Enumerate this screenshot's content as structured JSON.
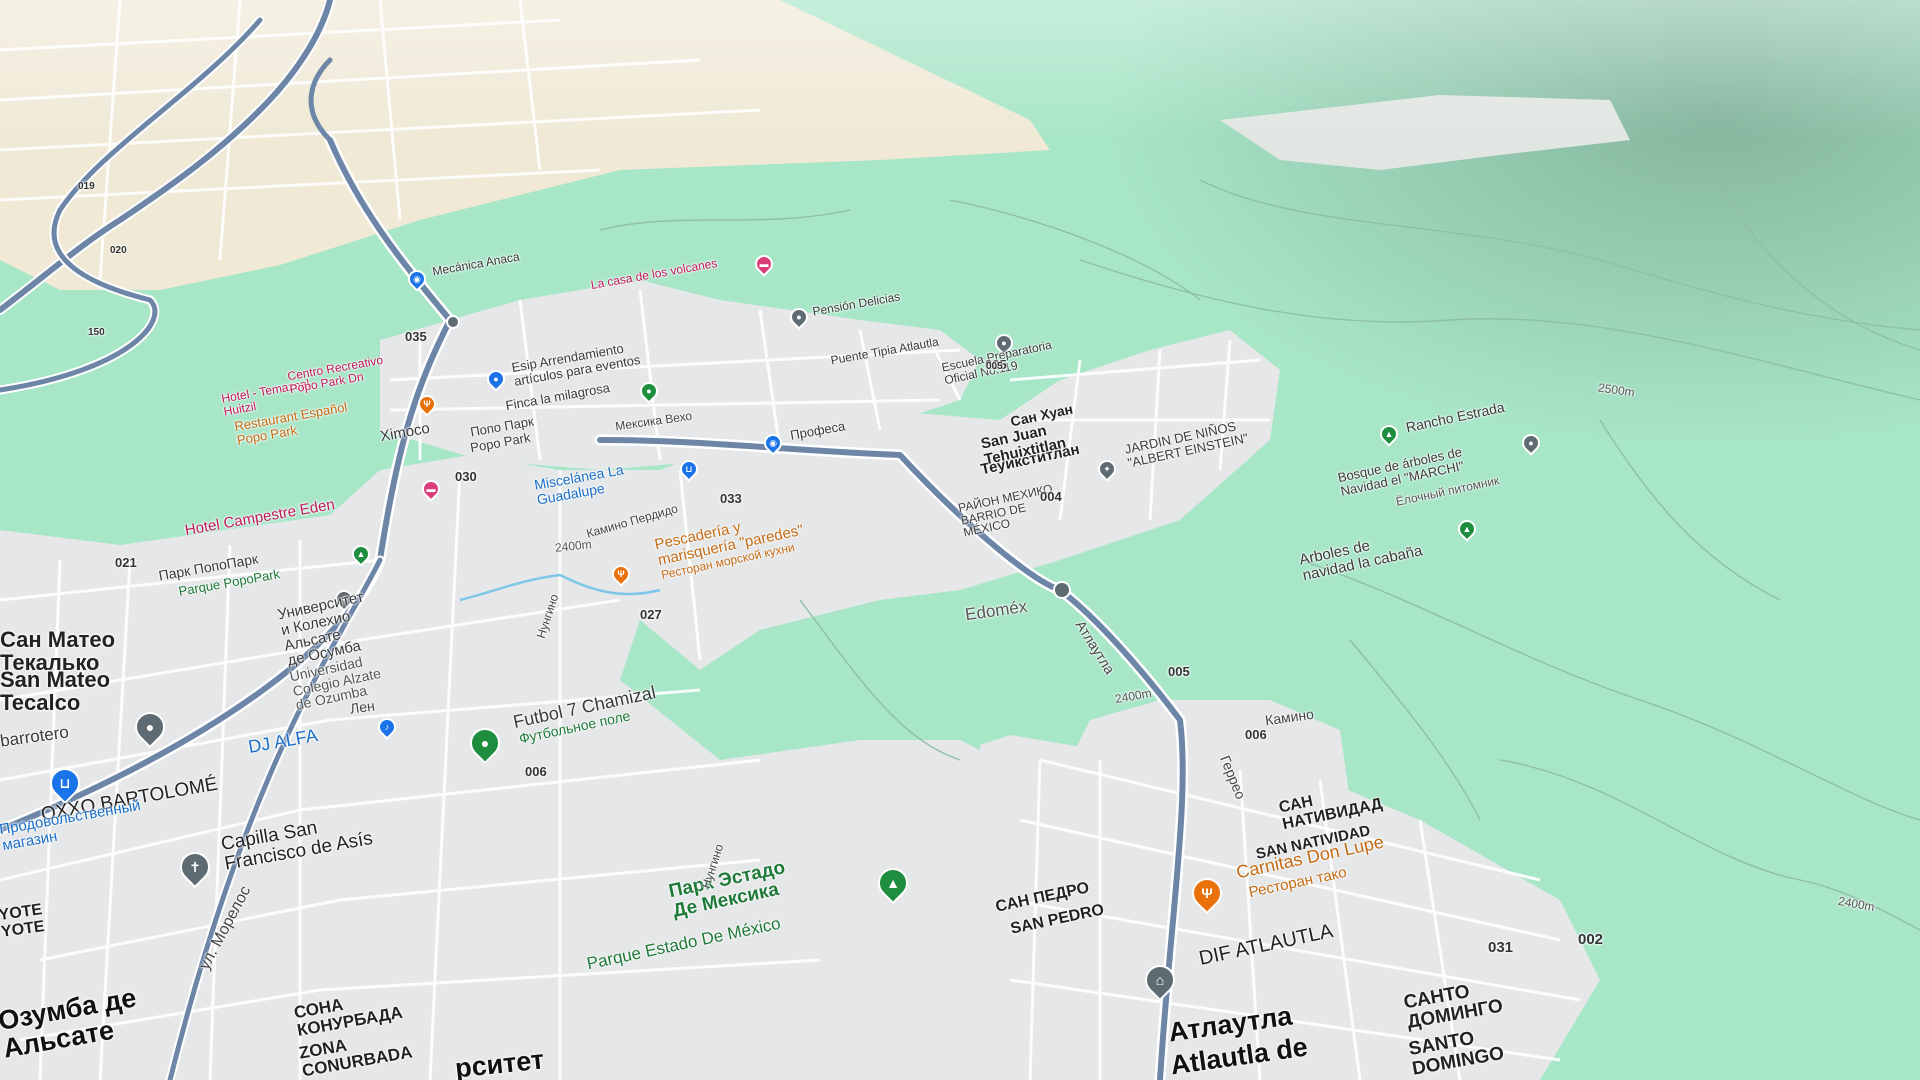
{
  "map": {
    "localities": [
      {
        "id": "san-mateo-ru",
        "text": "Сан Матео\nТекалько"
      },
      {
        "id": "san-mateo",
        "text": "San Mateo\nTecalco"
      },
      {
        "id": "atlautla-ru",
        "text": "Атлаутла"
      },
      {
        "id": "atlautla",
        "text": "Atlautla de"
      },
      {
        "id": "ozumba-ru",
        "text": "Озумба де\nАльсате"
      },
      {
        "id": "santo-domingo-ru",
        "text": "САНТО\nДОМИНГО"
      },
      {
        "id": "santo-domingo",
        "text": "SANTO\nDOMINGO"
      },
      {
        "id": "conurbada-ru",
        "text": "СОНА\nКОНУРБАДА"
      },
      {
        "id": "conurbada",
        "text": "ZONA\nCONURBADA"
      },
      {
        "id": "san-pedro-ru",
        "text": "САН ПЕДРО"
      },
      {
        "id": "san-pedro",
        "text": "SAN PEDRO"
      },
      {
        "id": "san-natividad-ru",
        "text": "САН\nНАТИВИДАД"
      },
      {
        "id": "san-natividad",
        "text": "SAN NATIVIDAD"
      },
      {
        "id": "tehuixtitlan-ru",
        "text": "Теуикститлан"
      },
      {
        "id": "tehuixtitlan",
        "text": "San Juan\nTehuixtitlan"
      },
      {
        "id": "san-juan-ru",
        "text": "Сан Хуан"
      },
      {
        "id": "edomex",
        "text": "Edoméx"
      },
      {
        "id": "ximoco",
        "text": "Ximoco"
      },
      {
        "id": "popo-park-ru",
        "text": "Попо Парк"
      },
      {
        "id": "popo-park",
        "text": "Popo Park"
      },
      {
        "id": "yote",
        "text": "YOTE\nYOTE"
      },
      {
        "id": "sitet",
        "text": "рситет"
      },
      {
        "id": "barrio-mexico",
        "text": "РАЙОН МЕХИКО\nBARRIO DE\nMÉXICO"
      }
    ],
    "pois": [
      {
        "id": "capilla",
        "icon": "cross-icon",
        "color": "gray",
        "name": "Capilla San\nFrancisco de Asís"
      },
      {
        "id": "parque-estado",
        "icon": "tree-icon",
        "color": "green",
        "name": "Парк Эстадо\nДе Мексика",
        "sub": "Parque Estado De México"
      },
      {
        "id": "carnitas",
        "icon": "fork-knife-icon",
        "color": "orange",
        "name": "Carnitas Don Lupe",
        "sub": "Ресторан тако"
      },
      {
        "id": "dif",
        "icon": "bank-icon",
        "color": "gray",
        "name": "DIF ATLAUTLA"
      },
      {
        "id": "futbol",
        "icon": "pin-icon",
        "color": "green",
        "name": "Futbol 7 Chamizal",
        "sub": "Футбольное поле"
      },
      {
        "id": "dj-alfa",
        "icon": "music-icon",
        "color": "blue",
        "name": "DJ ALFA"
      },
      {
        "id": "oxxo",
        "icon": "cart-icon",
        "color": "blue",
        "name": "OXXO BARTOLOMÉ",
        "sub": "Продовольственный\nмагазин"
      },
      {
        "id": "abarrotero",
        "icon": "pin-icon",
        "color": "gray",
        "name": "barrotero"
      },
      {
        "id": "universidad",
        "icon": "school-icon",
        "color": "gray",
        "name": "Университет\nи Колехио\nАльсате\nде Осумба",
        "sub": "Universidad\nColegio Alzate\nde Ozumba"
      },
      {
        "id": "parque-popo",
        "icon": "tree-icon",
        "color": "green",
        "name": "Парк ПопоПарк",
        "sub": "Parque PopoPark"
      },
      {
        "id": "pescaderia",
        "icon": "fork-knife-icon",
        "color": "orange",
        "name": "Pescadería y\nmarisquería \"paredes\"",
        "sub": "Ресторан морской кухни"
      },
      {
        "id": "hotel-campestre",
        "icon": "bed-icon",
        "color": "pink",
        "name": "Hotel Campestre Eden"
      },
      {
        "id": "miscelanea",
        "icon": "cart-icon",
        "color": "blue",
        "name": "Miscelánea La\nGuadalupe"
      },
      {
        "id": "restaurant-espanol",
        "icon": "fork-knife-icon",
        "color": "orange",
        "name": "Restaurant Español\nPopo Park"
      },
      {
        "id": "hotel-temazcal",
        "icon": "bed-icon",
        "color": "pink",
        "name": "Hotel - Temazcal\nHuitzil"
      },
      {
        "id": "centro-recreativo",
        "icon": "bed-icon",
        "color": "pink",
        "name": "Centro Recreativo\nPopo Park Dn"
      },
      {
        "id": "finca",
        "icon": "pin-icon",
        "color": "green",
        "name": "Finca la milagrosa"
      },
      {
        "id": "esip",
        "icon": "pin-icon",
        "color": "blue",
        "name": "Esip Arrendamiento\nartículos para eventos"
      },
      {
        "id": "jardin",
        "icon": "school-icon",
        "color": "gray",
        "name": "JARDIN DE NIÑOS\n\"ALBERT EINSTEIN\""
      },
      {
        "id": "rancho-estrada",
        "icon": "tree-icon",
        "color": "green",
        "name": "Rancho Estrada"
      },
      {
        "id": "bosque",
        "icon": "pin-icon",
        "color": "gray",
        "name": "Bosque de árboles de\nNavidad el \"MARCHI\"",
        "sub": "Ёлочный питомник"
      },
      {
        "id": "arboles-cabana",
        "icon": "tree-icon",
        "color": "green",
        "name": "Arboles de\nnavidad la cabaña"
      },
      {
        "id": "puente",
        "icon": "pin-icon",
        "color": "gray",
        "name": "Puente Tipia Atlautla"
      },
      {
        "id": "escuela-preparatoria",
        "icon": "school-icon",
        "color": "gray",
        "name": "Escuela Preparatoria\nOficial No.119"
      },
      {
        "id": "casa-volcanes",
        "icon": "bed-icon",
        "color": "pink",
        "name": "La casa de los volcanes"
      },
      {
        "id": "mecanica",
        "icon": "car-icon",
        "color": "blue",
        "name": "Mecánica Anaca"
      },
      {
        "id": "pension",
        "icon": "pin-icon",
        "color": "gray",
        "name": "Pensión Delicias"
      },
      {
        "id": "profeco",
        "icon": "car-icon",
        "color": "blue",
        "name": "Професа"
      }
    ],
    "roads": [
      {
        "id": "morelos",
        "text": "ул. Морелос"
      },
      {
        "id": "atlautla-rd",
        "text": "Атлаутла"
      },
      {
        "id": "kamino",
        "text": "Камино"
      },
      {
        "id": "gerredo",
        "text": "Геррео"
      },
      {
        "id": "nungino1",
        "text": "Нунгино"
      },
      {
        "id": "nungino2",
        "text": "Нунгино"
      },
      {
        "id": "len",
        "text": "Лен"
      },
      {
        "id": "mexiko-veho",
        "text": "Мексика Вехо"
      },
      {
        "id": "kamino-perdido",
        "text": "Камино Пердидо"
      }
    ],
    "numbers": [
      "006",
      "027",
      "021",
      "033",
      "030",
      "035",
      "004",
      "005",
      "031",
      "002",
      "005",
      "006",
      "150",
      "019",
      "020",
      "005"
    ],
    "elevations": [
      "2400m",
      "2400m",
      "2400m",
      "2500m"
    ],
    "colors": {
      "forest": "#a8e6c8",
      "urban": "#e6e8e9",
      "farmland": "#efe9d6",
      "highway": "#6d86a8",
      "road": "#ffffff"
    }
  }
}
